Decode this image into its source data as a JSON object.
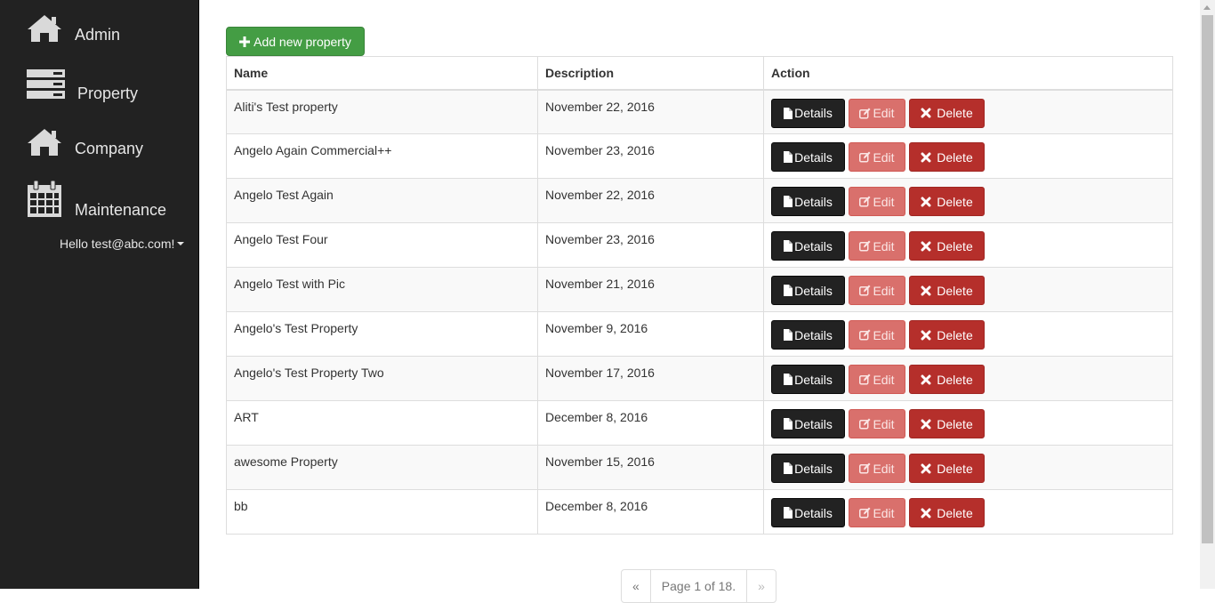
{
  "sidebar": {
    "items": [
      {
        "label": "Admin",
        "icon": "home-icon"
      },
      {
        "label": "Property",
        "icon": "server-icon"
      },
      {
        "label": "Company",
        "icon": "home-icon"
      },
      {
        "label": "Maintenance",
        "icon": "calendar-icon"
      }
    ],
    "user_greeting": "Hello test@abc.com!"
  },
  "toolbar": {
    "add_label": "Add new property"
  },
  "table": {
    "headers": {
      "name": "Name",
      "description": "Description",
      "action": "Action"
    },
    "rows": [
      {
        "name": "Aliti's Test property",
        "description": "November 22, 2016"
      },
      {
        "name": "Angelo Again Commercial++",
        "description": "November 23, 2016"
      },
      {
        "name": "Angelo Test Again",
        "description": "November 22, 2016"
      },
      {
        "name": "Angelo Test Four",
        "description": "November 23, 2016"
      },
      {
        "name": "Angelo Test with Pic",
        "description": "November 21, 2016"
      },
      {
        "name": "Angelo's Test Property",
        "description": "November 9, 2016"
      },
      {
        "name": "Angelo's Test Property Two",
        "description": "November 17, 2016"
      },
      {
        "name": "ART",
        "description": "December 8, 2016"
      },
      {
        "name": "awesome Property",
        "description": "November 15, 2016"
      },
      {
        "name": "bb",
        "description": "December 8, 2016"
      }
    ],
    "actions": {
      "details": "Details",
      "edit": "Edit",
      "delete": "Delete"
    }
  },
  "pager": {
    "prev": "«",
    "status": "Page 1 of 18.",
    "next": "»"
  },
  "colors": {
    "sidebar_bg": "#222222",
    "add_button": "#449d44",
    "details_button": "#222222",
    "edit_button": "#d9706c",
    "delete_button": "#b52f2b"
  }
}
